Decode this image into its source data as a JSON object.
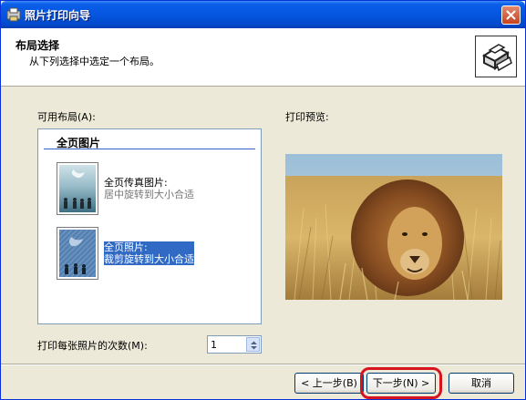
{
  "window": {
    "title": "照片打印向导"
  },
  "header": {
    "title": "布局选择",
    "subtitle": "从下列选择中选定一个布局。"
  },
  "layouts": {
    "label": "可用布局(A):",
    "group": "全页图片",
    "items": [
      {
        "line1": "全页传真图片:",
        "line2": "居中旋转到大小合适",
        "selected": false
      },
      {
        "line1": "全页照片:",
        "line2": "裁剪旋转到大小合适",
        "selected": true
      }
    ]
  },
  "preview": {
    "label": "打印预览:"
  },
  "copies": {
    "label": "打印每张照片的次数(M):",
    "value": "1"
  },
  "buttons": {
    "back": "< 上一步(B)",
    "next": "下一步(N) >",
    "cancel": "取消"
  },
  "colors": {
    "titlebar": "#0556e0",
    "dialog_bg": "#ece9d8",
    "selection": "#316ac5",
    "highlight_ring": "#d7141e"
  },
  "icons": {
    "app": "printer-photo-icon",
    "close": "close-icon",
    "wizard": "printer-wizard-icon",
    "spin": "spin-updown-icon"
  }
}
